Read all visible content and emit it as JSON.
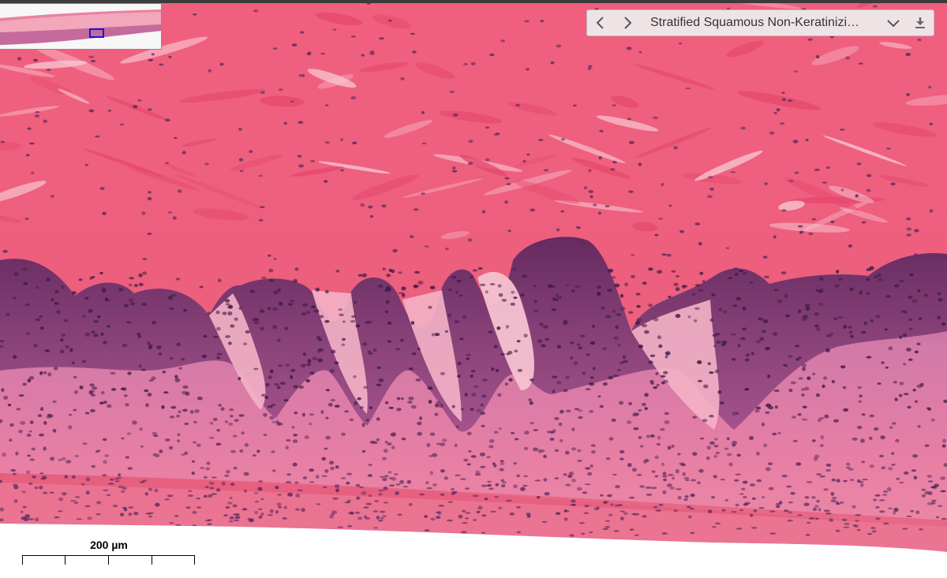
{
  "viewer": {
    "slide_title": "Stratified Squamous Non-Keratinizi…",
    "scale_bar_label": "200 µm",
    "controls": {
      "prev_icon": "chevron-left-icon",
      "next_icon": "chevron-right-icon",
      "dropdown_icon": "chevron-down-icon",
      "download_icon": "download-icon"
    }
  },
  "colors": {
    "stroma": "#ee5a7a",
    "epithelium": "#d87aaa",
    "basal_layer": "#6b2d63",
    "nuclei": "#4a1e4c",
    "background": "#ffffff",
    "minimap_highlight": "#1515e0"
  }
}
